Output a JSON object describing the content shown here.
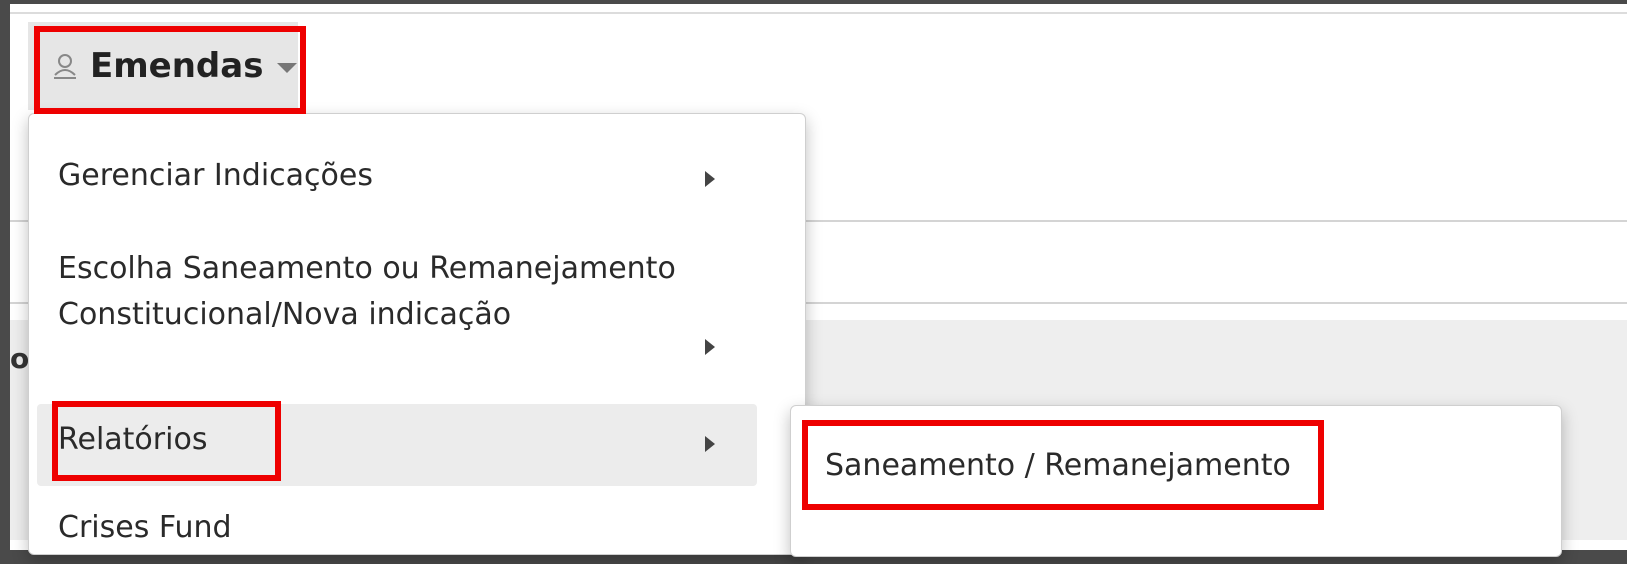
{
  "menu": {
    "toggle_label": "Emendas",
    "icon": "user-icon",
    "caret_icon": "caret-down-icon",
    "items": [
      {
        "label": "Gerenciar Indicações",
        "has_submenu": true
      },
      {
        "label": "Escolha Saneamento ou Remanejamento Constitucional/Nova indicação",
        "has_submenu": true
      },
      {
        "label": "Relatórios",
        "has_submenu": true,
        "active": true
      },
      {
        "label": "Crises Fund",
        "has_submenu": false
      }
    ]
  },
  "submenu": {
    "items": [
      {
        "label": "Saneamento / Remanejamento"
      }
    ]
  },
  "background": {
    "partial_text": "o"
  },
  "colors": {
    "highlight": "#ee0000",
    "toggle_bg": "#e6e6e6",
    "active_item_bg": "#ececec",
    "frame_bg": "#4a4a4a"
  }
}
